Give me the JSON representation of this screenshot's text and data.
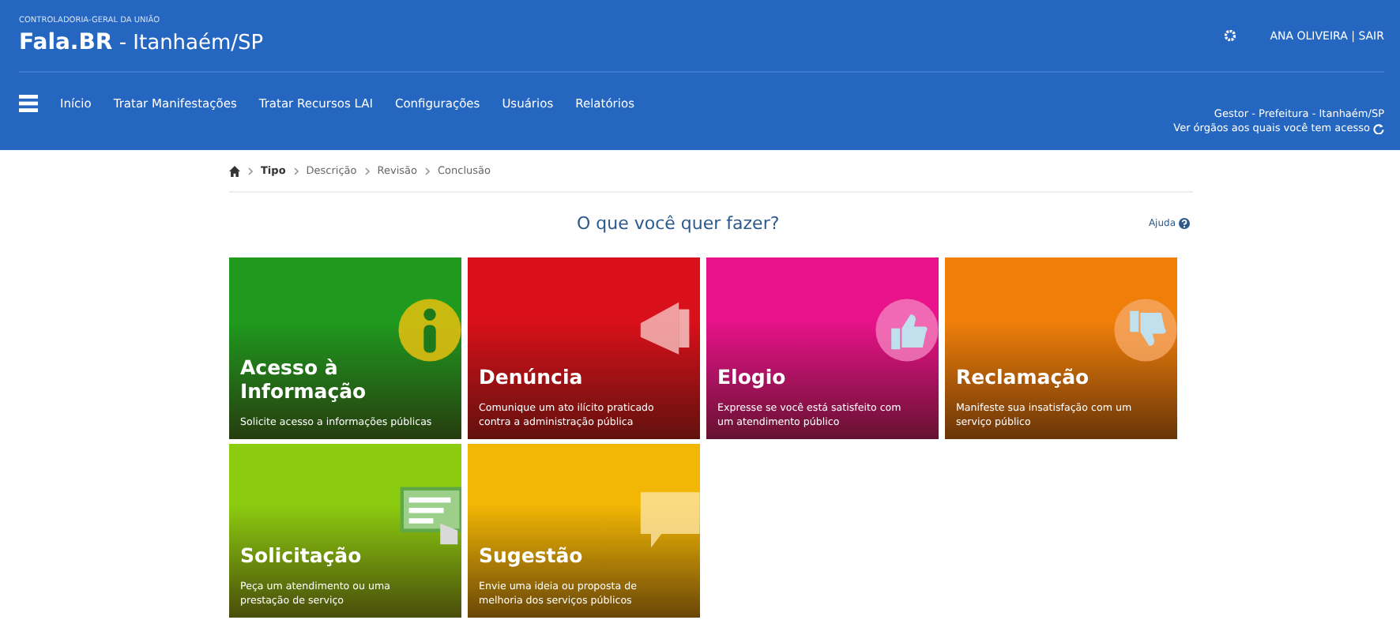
{
  "header": {
    "agency": "CONTROLADORIA-GERAL DA UNIÃO",
    "brand": "Fala.BR",
    "unit": " - Itanhaém/SP",
    "user": "ANA OLIVEIRA | SAIR"
  },
  "menu": [
    "Início",
    "Tratar Manifestações",
    "Tratar Recursos LAI",
    "Configurações",
    "Usuários",
    "Relatórios"
  ],
  "profile": {
    "role": "Gestor - Prefeitura - Itanhaém/SP",
    "switch": "Ver órgãos aos quais você tem acesso"
  },
  "breadcrumb": [
    {
      "label": "Tipo",
      "selected": true
    },
    {
      "label": "Descrição",
      "selected": false
    },
    {
      "label": "Revisão",
      "selected": false
    },
    {
      "label": "Conclusão",
      "selected": false
    }
  ],
  "heading": "O que você quer fazer?",
  "help": "Ajuda",
  "cards": [
    {
      "title": "Acesso à Informação",
      "text": "Solicite acesso a informações públicas",
      "color": "#1f9a1f"
    },
    {
      "title": "Denúncia",
      "text": "Comunique um ato ilícito praticado contra a administração pública",
      "color": "#d9101a"
    },
    {
      "title": "Elogio",
      "text": "Expresse se você está satisfeito com um atendimento público",
      "color": "#e8128a"
    },
    {
      "title": "Reclamação",
      "text": "Manifeste sua insatisfação com um serviço público",
      "color": "#f07f0a"
    },
    {
      "title": "Solicitação",
      "text": "Peça um atendimento ou uma prestação de serviço",
      "color": "#8ccc10"
    },
    {
      "title": "Sugestão",
      "text": "Envie uma ideia ou proposta de melhoria dos serviços públicos",
      "color": "#f2b705"
    }
  ]
}
